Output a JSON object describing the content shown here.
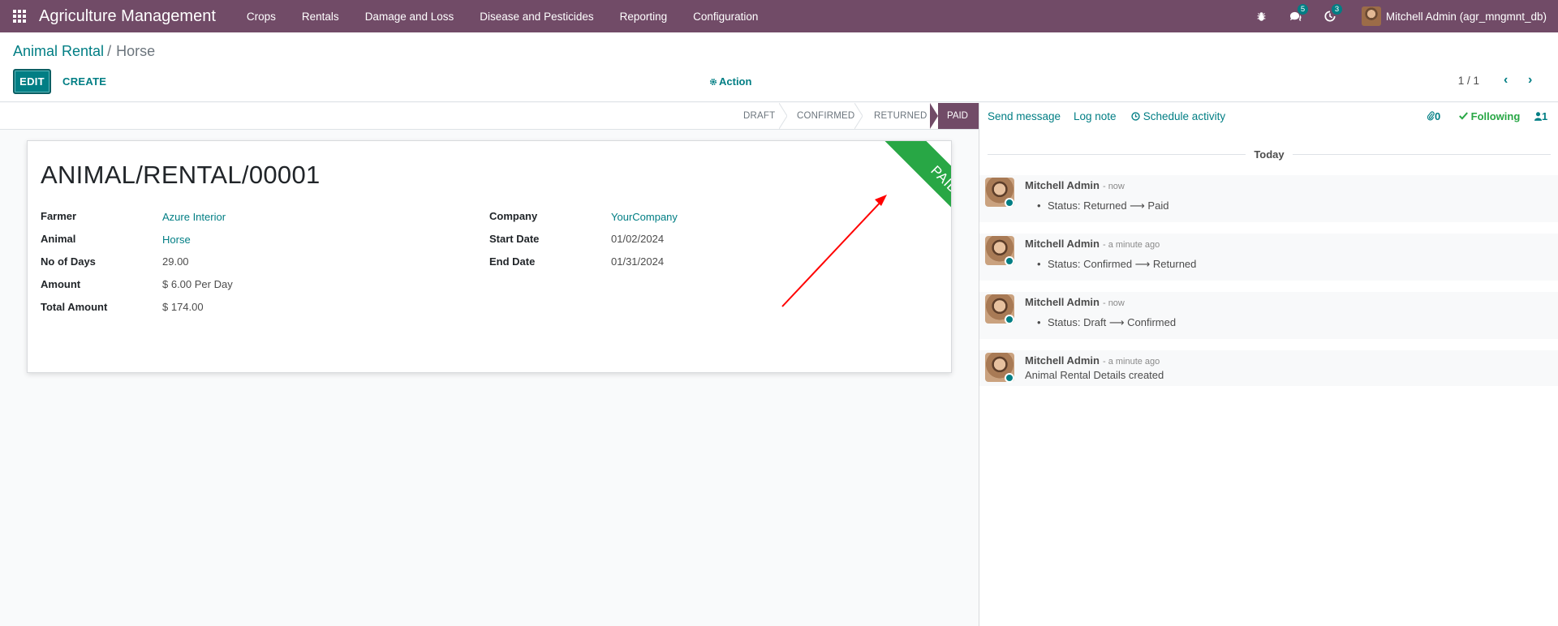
{
  "navbar": {
    "brand": "Agriculture Management",
    "menu": [
      "Crops",
      "Rentals",
      "Damage and Loss",
      "Disease and Pesticides",
      "Reporting",
      "Configuration"
    ],
    "messages_badge": "5",
    "activities_badge": "3",
    "user": "Mitchell Admin (agr_mngmnt_db)"
  },
  "breadcrumb": {
    "parent": "Animal Rental",
    "separator": "/",
    "current": "Horse"
  },
  "toolbar": {
    "edit_label": "EDIT",
    "create_label": "CREATE",
    "action_label": "Action",
    "pager": "1 / 1"
  },
  "statusbar": {
    "stages": [
      "DRAFT",
      "CONFIRMED",
      "RETURNED",
      "PAID"
    ],
    "active": "PAID",
    "active_color": "#714b67"
  },
  "form": {
    "title": "ANIMAL/RENTAL/00001",
    "ribbon": "PAID",
    "ribbon_color": "#28a745",
    "left_fields": [
      {
        "label": "Farmer",
        "value": "Azure Interior"
      },
      {
        "label": "Animal",
        "value": "Horse"
      },
      {
        "label": "No of Days",
        "value": "29.00"
      },
      {
        "label": "Amount",
        "value": "$ 6.00 Per Day"
      },
      {
        "label": "Total Amount",
        "value": "$ 174.00"
      }
    ],
    "right_fields": [
      {
        "label": "Company",
        "value": "YourCompany"
      },
      {
        "label": "Start Date",
        "value": "01/02/2024"
      },
      {
        "label": "End Date",
        "value": "01/31/2024"
      }
    ]
  },
  "chatter": {
    "send_message": "Send message",
    "log_note": "Log note",
    "schedule_activity": "Schedule activity",
    "attachments": "0",
    "following": "Following",
    "followers": "1",
    "today": "Today",
    "messages": [
      {
        "author": "Mitchell Admin",
        "date": "- now",
        "body": "Status: Returned ⟶ Paid"
      },
      {
        "author": "Mitchell Admin",
        "date": "- a minute ago",
        "body": "Status: Confirmed ⟶ Returned"
      },
      {
        "author": "Mitchell Admin",
        "date": "- now",
        "body": "Status: Draft ⟶ Confirmed"
      },
      {
        "author": "Mitchell Admin",
        "date": "- a minute ago",
        "body": "Animal Rental Details created"
      }
    ]
  },
  "annotation": {
    "arrow_color": "#ff0000"
  }
}
